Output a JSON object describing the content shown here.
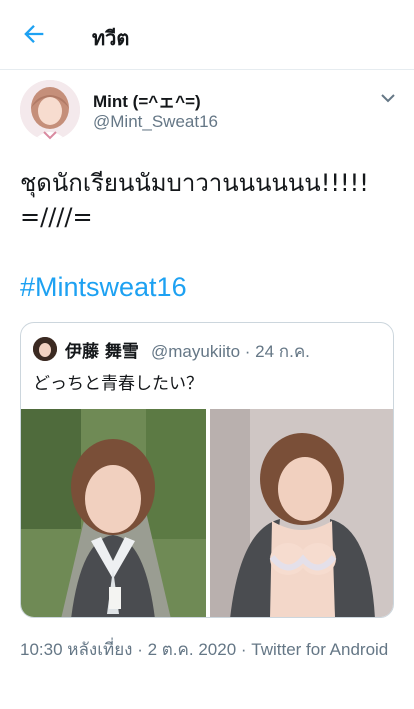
{
  "header": {
    "title": "ทวีต",
    "back_icon": "arrow-left-icon",
    "accent_color": "#1da1f2"
  },
  "tweet": {
    "author": {
      "display_name": "Mint (=^ェ^=)",
      "handle": "@Mint_Sweat16"
    },
    "text": "ชุดนักเรียนนัมบาวานนนนนน!!!!!\n=////=",
    "hashtag": "#Mintsweat16",
    "timestamp": "10:30 หลังเที่ยง · 2 ต.ค. 2020 · Twitter for Android"
  },
  "quote": {
    "author_name": "伊藤 舞雪",
    "meta": "@mayukiito · 24 ก.ค.",
    "text": "どっちと青春したい？"
  }
}
